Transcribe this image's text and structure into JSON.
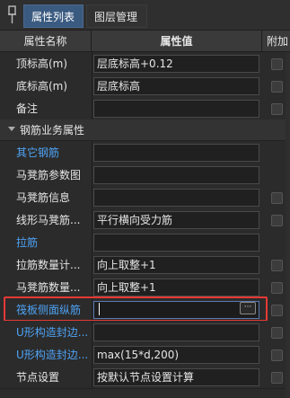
{
  "tabs": [
    {
      "label": "属性列表",
      "active": true
    },
    {
      "label": "图层管理",
      "active": false
    }
  ],
  "header": {
    "name_col": "属性名称",
    "value_col": "属性值",
    "add_col": "附加"
  },
  "rows": [
    {
      "name": "顶标高(m)",
      "value": "层底标高+0.12",
      "blue": false
    },
    {
      "name": "底标高(m)",
      "value": "层底标高",
      "blue": false
    },
    {
      "name": "备注",
      "value": "",
      "blue": false
    }
  ],
  "section": {
    "label": "钢筋业务属性"
  },
  "rebar_rows": [
    {
      "name": "其它钢筋",
      "value": "",
      "blue": true
    },
    {
      "name": "马凳筋参数图",
      "value": "",
      "blue": false
    },
    {
      "name": "马凳筋信息",
      "value": "",
      "blue": false
    },
    {
      "name": "线形马凳筋...",
      "value": "平行横向受力筋",
      "blue": false
    },
    {
      "name": "拉筋",
      "value": "",
      "blue": true
    },
    {
      "name": "拉筋数量计...",
      "value": "向上取整+1",
      "blue": false
    },
    {
      "name": "马凳筋数量...",
      "value": "向上取整+1",
      "blue": false
    },
    {
      "name": "筏板侧面纵筋",
      "value": "",
      "blue": true
    },
    {
      "name": "U形构造封边...",
      "value": "",
      "blue": true
    },
    {
      "name": "U形构造封边...",
      "value": "max(15*d,200)",
      "blue": true
    },
    {
      "name": "节点设置",
      "value": "按默认节点设置计算",
      "blue": false
    }
  ],
  "more_button": "···",
  "colors": {
    "accent_tab": "#3a5a80",
    "highlight_border": "#e53935",
    "blue_text": "#4ea3f5"
  }
}
